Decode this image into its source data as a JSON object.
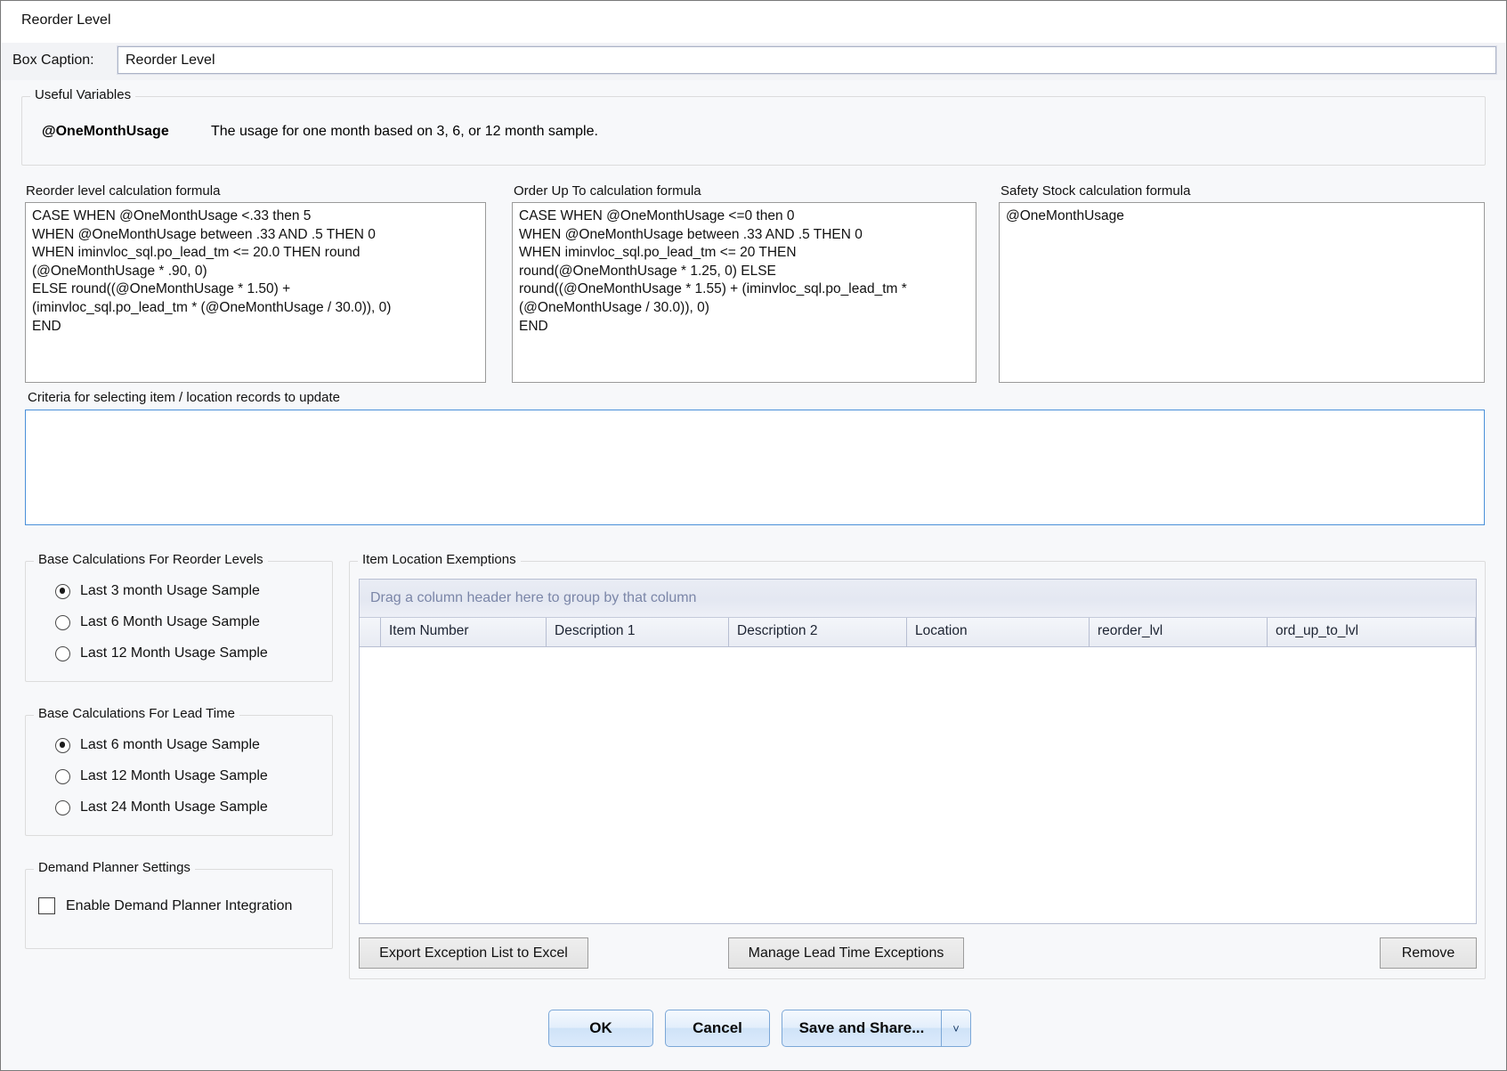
{
  "window": {
    "title": "Reorder Level"
  },
  "caption": {
    "label": "Box Caption:",
    "value": "Reorder Level",
    "placeholder": ""
  },
  "useful_variables": {
    "title": "Useful Variables",
    "variable_name": "@OneMonthUsage",
    "variable_description": "The usage for one month based on 3, 6, or 12 month sample."
  },
  "formulas": {
    "reorder_level": {
      "label": "Reorder level calculation formula",
      "value": "CASE WHEN @OneMonthUsage <.33 then 5\nWHEN @OneMonthUsage between .33 AND .5 THEN 0\nWHEN iminvloc_sql.po_lead_tm <= 20.0 THEN round\n(@OneMonthUsage * .90, 0)\nELSE round((@OneMonthUsage * 1.50) +\n(iminvloc_sql.po_lead_tm * (@OneMonthUsage / 30.0)), 0)\nEND"
    },
    "order_up_to": {
      "label": "Order Up To calculation formula",
      "value": "CASE WHEN @OneMonthUsage <=0 then 0\nWHEN @OneMonthUsage between .33 AND .5 THEN 0\nWHEN iminvloc_sql.po_lead_tm <= 20 THEN\nround(@OneMonthUsage * 1.25, 0) ELSE\nround((@OneMonthUsage * 1.55) + (iminvloc_sql.po_lead_tm *\n(@OneMonthUsage / 30.0)), 0)\nEND"
    },
    "safety_stock": {
      "label": "Safety Stock calculation formula",
      "value": "@OneMonthUsage"
    }
  },
  "criteria": {
    "label": "Criteria for selecting item / location records  to update",
    "value": "",
    "placeholder": ""
  },
  "base_calc_reorder": {
    "title": "Base Calculations For Reorder Levels",
    "options": [
      {
        "label": "Last 3 month Usage Sample",
        "selected": true
      },
      {
        "label": "Last 6 Month Usage Sample",
        "selected": false
      },
      {
        "label": "Last 12 Month Usage Sample",
        "selected": false
      }
    ]
  },
  "base_calc_lead_time": {
    "title": "Base Calculations For Lead Time",
    "options": [
      {
        "label": "Last 6 month Usage Sample",
        "selected": true
      },
      {
        "label": "Last 12 Month Usage Sample",
        "selected": false
      },
      {
        "label": "Last 24 Month Usage Sample",
        "selected": false
      }
    ]
  },
  "demand_planner": {
    "title": "Demand Planner Settings",
    "checkbox_label": "Enable Demand Planner Integration",
    "checked": false
  },
  "exemptions": {
    "title": "Item Location Exemptions",
    "group_hint": "Drag a column header here to group by that column",
    "columns": [
      "Item Number",
      "Description 1",
      "Description 2",
      "Location",
      "reorder_lvl",
      "ord_up_to_lvl"
    ],
    "rows": [],
    "buttons": {
      "export": "Export Exception List to Excel",
      "manage": "Manage Lead Time Exceptions",
      "remove": "Remove"
    }
  },
  "footer": {
    "ok": "OK",
    "cancel": "Cancel",
    "save_and_share": "Save and Share...",
    "split_chevron": "˅"
  },
  "colors": {
    "surface": "#f7f8fa",
    "focus_border": "#4a90d9",
    "grid_header": "#e8ebf3",
    "group_hint_text": "#7b86a8",
    "button_face": "#e3e3e3"
  }
}
